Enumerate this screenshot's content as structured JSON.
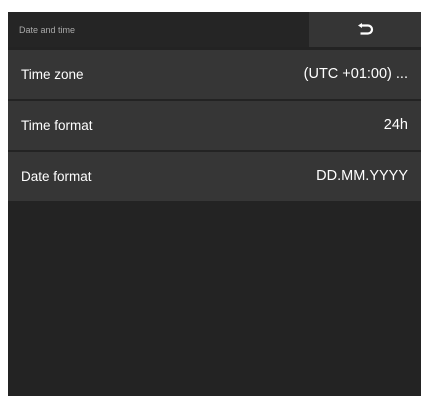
{
  "header": {
    "title": "Date and time",
    "back_icon": "undo-arrow-icon"
  },
  "settings": [
    {
      "label": "Time zone",
      "value": "(UTC +01:00) ..."
    },
    {
      "label": "Time format",
      "value": "24h"
    },
    {
      "label": "Date format",
      "value": "DD.MM.YYYY"
    }
  ],
  "colors": {
    "background": "#232323",
    "row": "#363636",
    "back_button": "#353535"
  }
}
